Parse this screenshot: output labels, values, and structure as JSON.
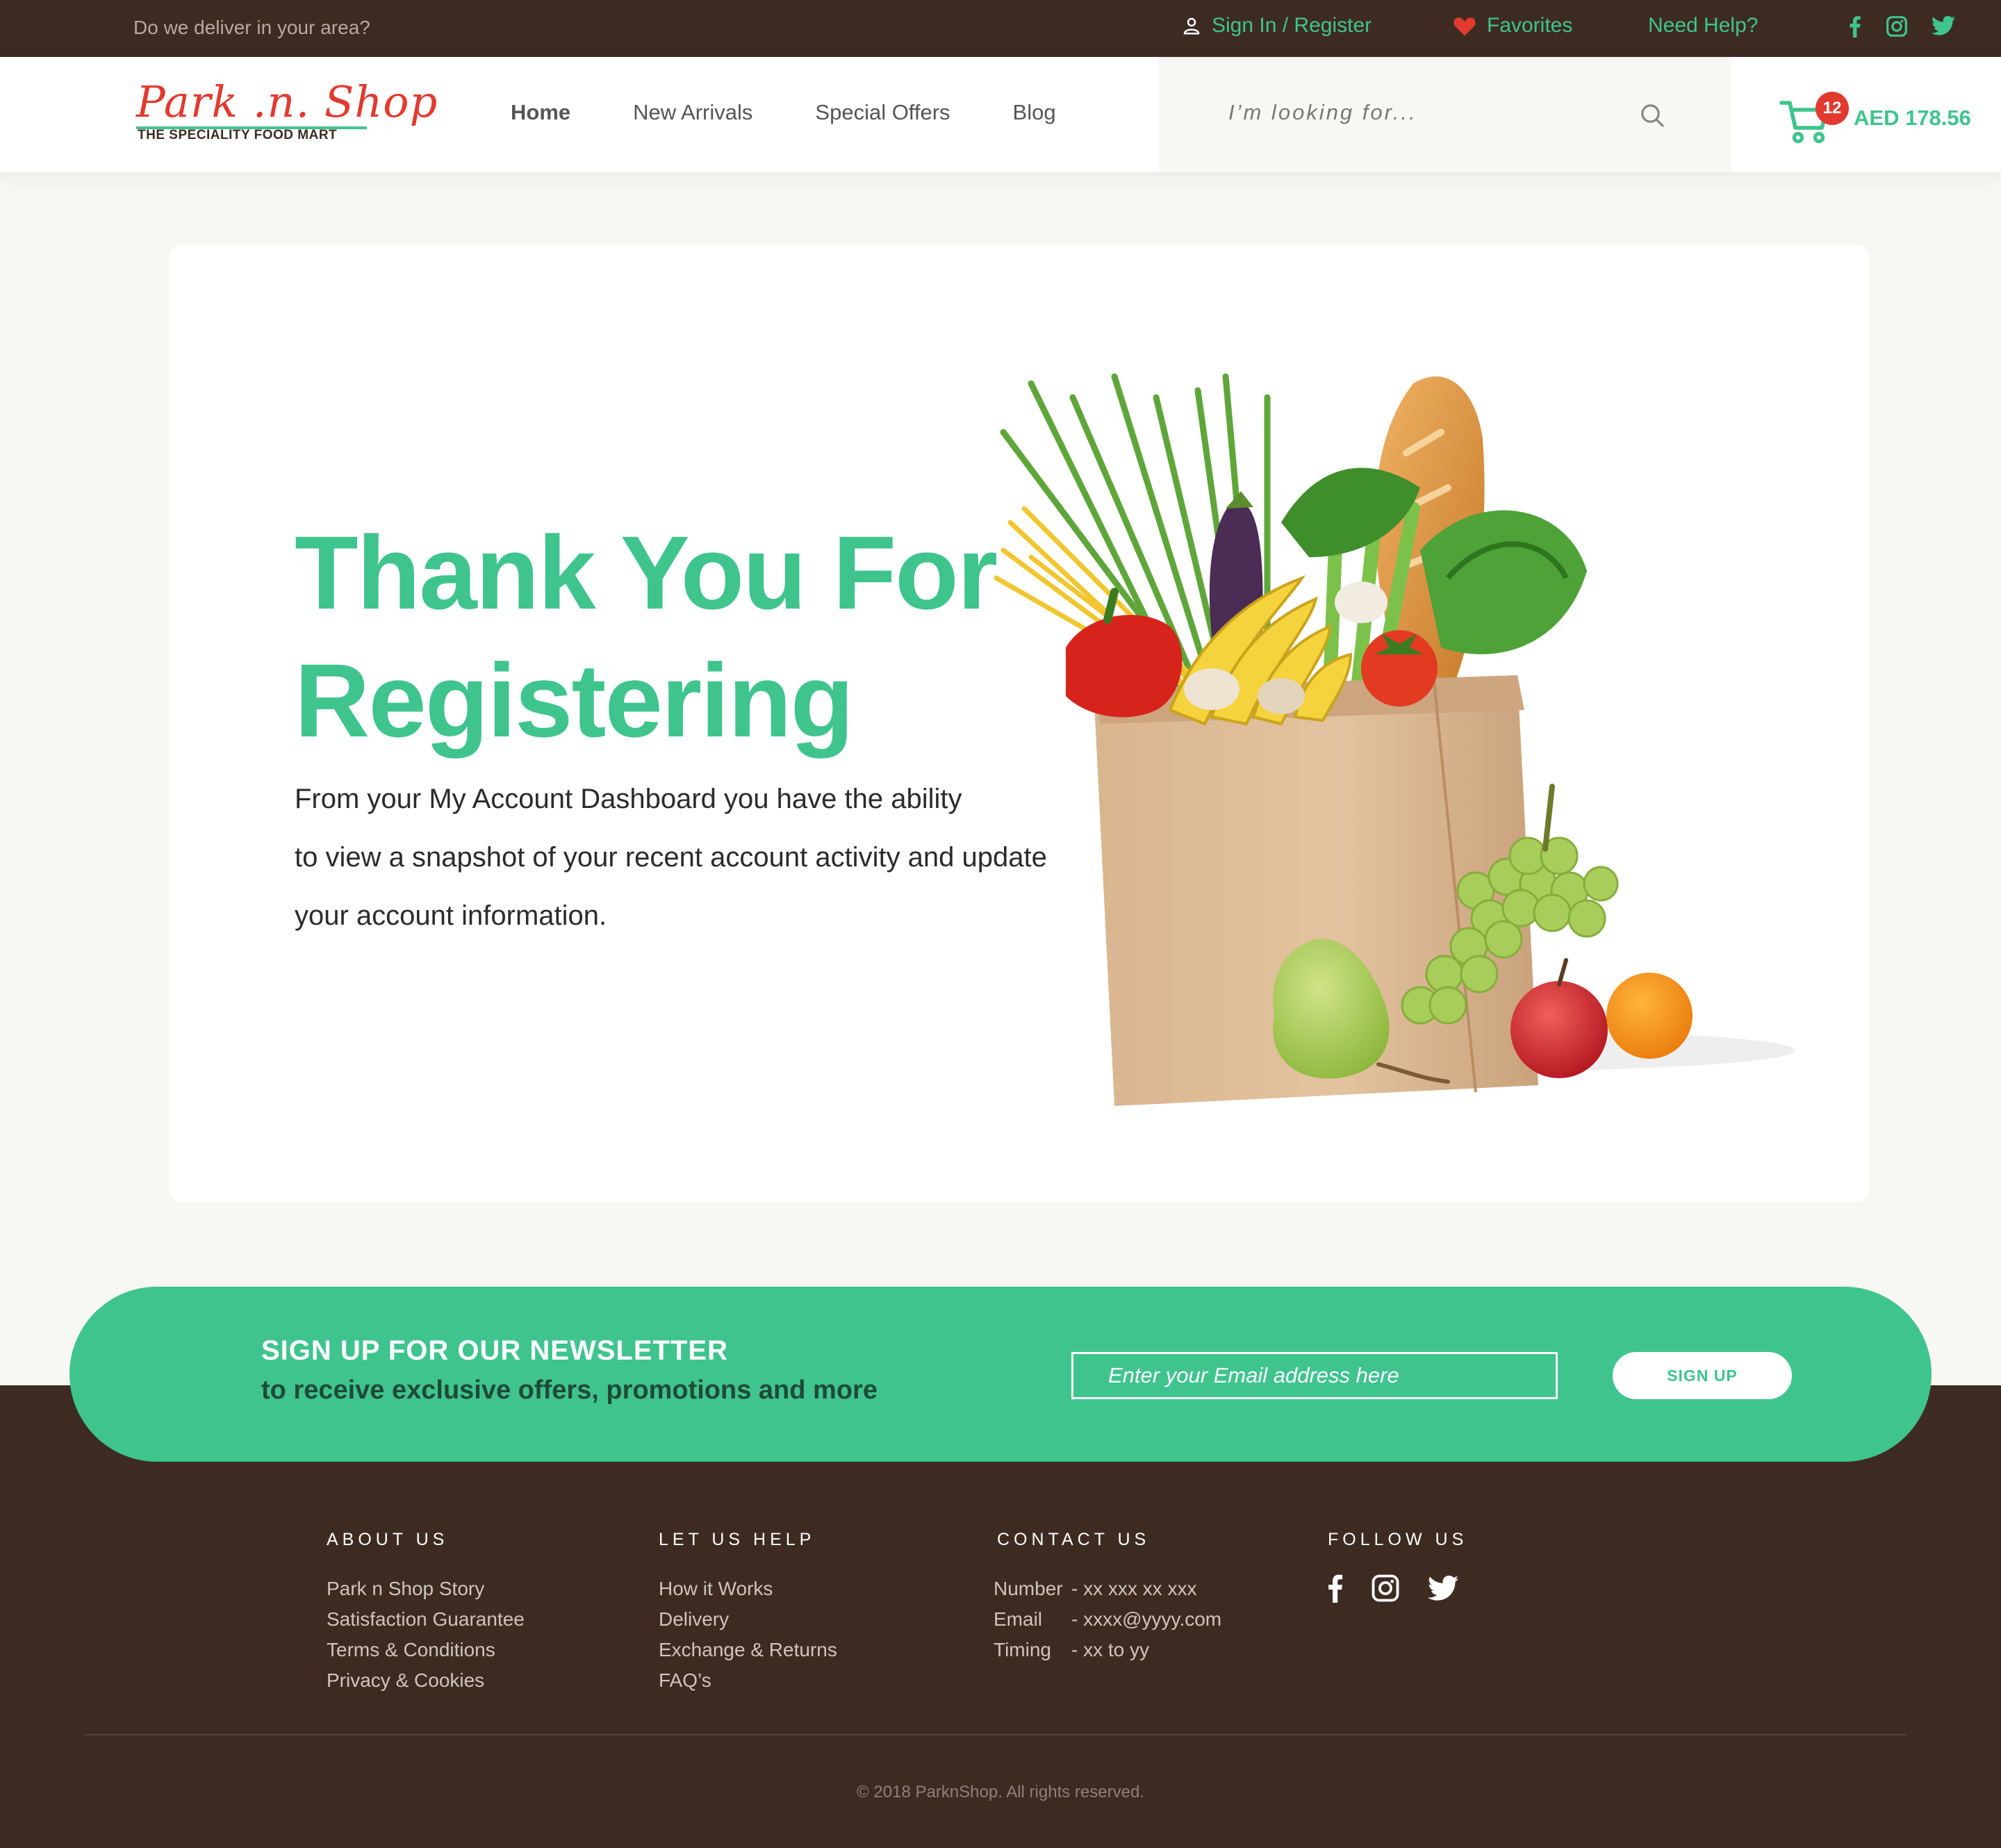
{
  "topbar": {
    "deliver_text": "Do we deliver in your area?",
    "signin": "Sign In / Register",
    "favorites": "Favorites",
    "help": "Need Help?",
    "social_icons": [
      "facebook-icon",
      "instagram-icon",
      "twitter-icon"
    ]
  },
  "header": {
    "logo_script": "Park .n. Shop",
    "logo_tagline": "THE SPECIALITY FOOD MART",
    "nav": [
      "Home",
      "New Arrivals",
      "Special Offers",
      "Blog"
    ],
    "search_placeholder": "I’m looking for...",
    "cart_count": "12",
    "cart_amount": "AED 178.56"
  },
  "main": {
    "title_line1": "Thank You For",
    "title_line2": "Registering",
    "lead_line1": "From your My Account Dashboard you have the ability",
    "lead_line2": "to view a snapshot of your recent account activity and update",
    "lead_line3": "your account information."
  },
  "newsletter": {
    "title": "SIGN UP FOR OUR NEWSLETTER",
    "subtitle": "to receive exclusive offers, promotions and more",
    "placeholder": "Enter your Email address here",
    "button": "SIGN UP"
  },
  "footer": {
    "about": {
      "heading": "ABOUT US",
      "links": [
        "Park n Shop Story",
        "Satisfaction Guarantee",
        "Terms & Conditions",
        "Privacy & Cookies"
      ]
    },
    "help": {
      "heading": "LET US HELP",
      "links": [
        "How it Works",
        "Delivery",
        "Exchange & Returns",
        "FAQ’s"
      ]
    },
    "contact": {
      "heading": "CONTACT US",
      "rows": [
        {
          "label": "Number",
          "value": "- xx xxx xx xxx"
        },
        {
          "label": "Email",
          "value": "- xxxx@yyyy.com"
        },
        {
          "label": "Timing",
          "value": "- xx to yy"
        }
      ]
    },
    "follow": {
      "heading": "FOLLOW US"
    },
    "copyright": "© 2018 ParknShop. All rights reserved."
  },
  "colors": {
    "brand_green": "#3fc48d",
    "dark_brown": "#3d2b22",
    "logo_red": "#e23a2e",
    "page_bg": "#f7f7f3"
  }
}
